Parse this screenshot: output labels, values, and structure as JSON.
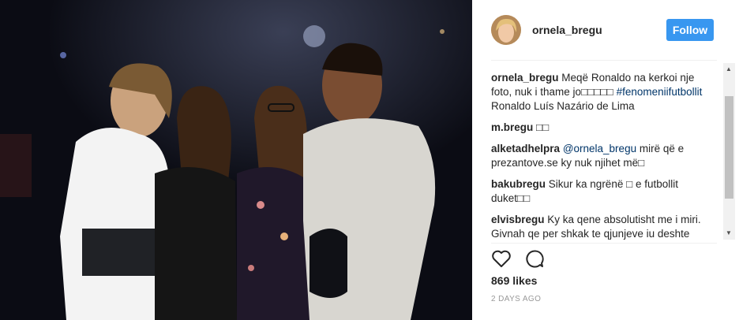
{
  "post": {
    "username": "ornela_bregu",
    "follow_label": "Follow",
    "likes": "869 likes",
    "time_ago": "2 DAYS AGO"
  },
  "comments": [
    {
      "user": "ornela_bregu",
      "parts": [
        {
          "text": "Meqë Ronaldo na kerkoi nje foto, nuk i thame jo□□□□□ "
        },
        {
          "text": "#fenomeniifutbollit",
          "link": true
        },
        {
          "text": " Ronaldo Luís Nazário de Lima"
        }
      ]
    },
    {
      "user": "m.bregu",
      "parts": [
        {
          "text": "□□"
        }
      ]
    },
    {
      "user": "alketadhelpra",
      "parts": [
        {
          "text": "@ornela_bregu",
          "link": true
        },
        {
          "text": " mirë që e prezantove.se ky nuk njihet më□"
        }
      ]
    },
    {
      "user": "bakubregu",
      "parts": [
        {
          "text": "Sikur ka ngrënë □ e futbollit duket□□"
        }
      ]
    },
    {
      "user": "elvisbregu",
      "parts": [
        {
          "text": "Ky ka qene absolutisht me i miri. Givnah qe per shkak te qjunjeve iu deshte"
        }
      ]
    }
  ],
  "icons": {
    "like": "heart-icon",
    "comment": "comment-bubble-icon"
  },
  "colors": {
    "follow_button": "#3897f0",
    "link": "#003569",
    "muted": "#999999"
  }
}
